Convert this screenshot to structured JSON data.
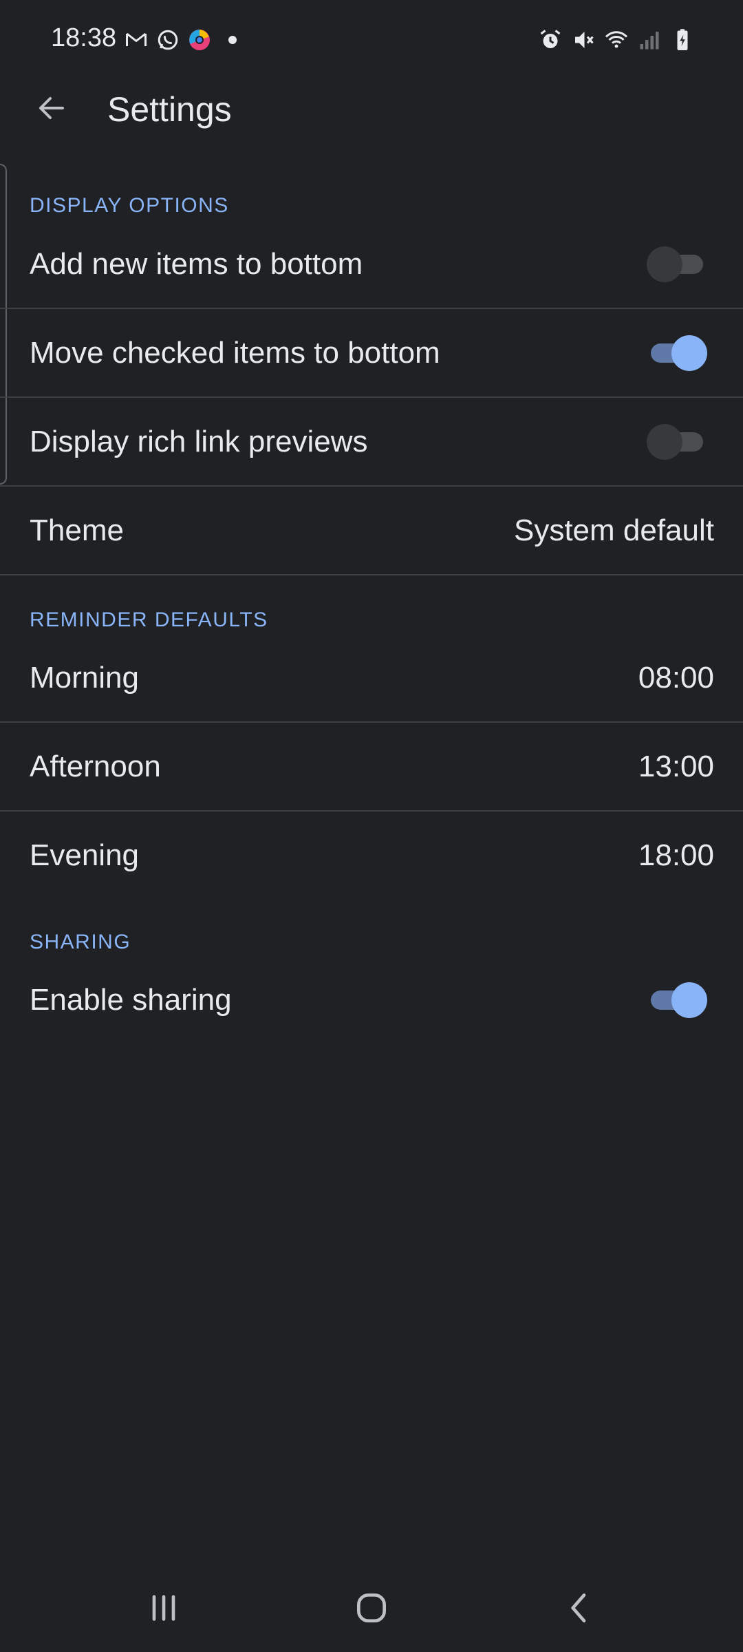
{
  "status_bar": {
    "time": "18:38",
    "left_icons": [
      "gmail-icon",
      "whatsapp-icon",
      "chrome-like-app-icon",
      "notification-dot-icon"
    ],
    "right_icons": [
      "alarm-icon",
      "mute-icon",
      "wifi-icon",
      "signal-icon",
      "battery-charging-icon"
    ]
  },
  "app_bar": {
    "title": "Settings",
    "back_icon": "arrow-back-icon"
  },
  "display_options": {
    "header": "DISPLAY OPTIONS",
    "items": [
      {
        "label": "Add new items to bottom",
        "toggle": false
      },
      {
        "label": "Move checked items to bottom",
        "toggle": true
      },
      {
        "label": "Display rich link previews",
        "toggle": false
      }
    ]
  },
  "theme": {
    "label": "Theme",
    "value": "System default"
  },
  "reminder_defaults": {
    "header": "REMINDER DEFAULTS",
    "items": [
      {
        "label": "Morning",
        "value": "08:00"
      },
      {
        "label": "Afternoon",
        "value": "13:00"
      },
      {
        "label": "Evening",
        "value": "18:00"
      }
    ]
  },
  "sharing": {
    "header": "SHARING",
    "items": [
      {
        "label": "Enable sharing",
        "toggle": true
      }
    ]
  },
  "nav_bar": {
    "buttons": [
      "recents-icon",
      "home-icon",
      "back-icon"
    ]
  },
  "colors": {
    "background": "#202124",
    "accent": "#8ab4f8",
    "text": "#e8eaed",
    "divider": "#3c4043"
  }
}
